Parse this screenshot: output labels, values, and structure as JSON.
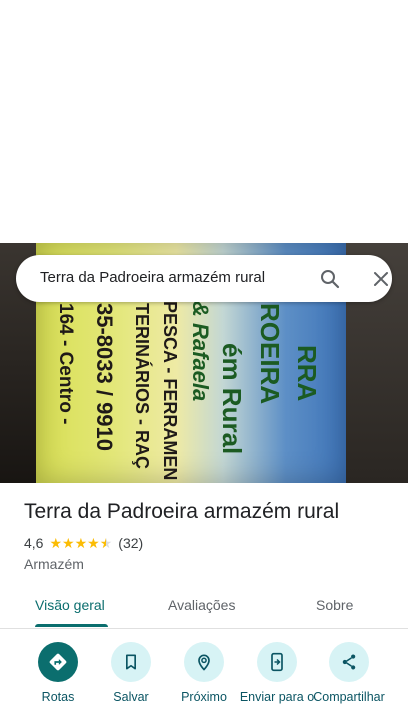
{
  "search": {
    "query": "Terra da Padroeira armazém rural"
  },
  "photo_text": {
    "line1": "RRA",
    "line2": "ROEIRA",
    "line3": "ém Rural",
    "line4": "& Rafaela",
    "line5": "PESCA - FERRAMEN",
    "line6": "TERINÁRIOS - RAÇ",
    "line7": "35-8033 / 9910",
    "line8": "164 - Centro -"
  },
  "place": {
    "title": "Terra da Padroeira armazém rural",
    "rating": "4,6",
    "reviews": "(32)",
    "category": "Armazém",
    "stars_value": 4.6
  },
  "tabs": [
    "Visão geral",
    "Avaliações",
    "Sobre"
  ],
  "actions": [
    {
      "label": "Rotas",
      "icon": "directions-icon"
    },
    {
      "label": "Salvar",
      "icon": "bookmark-icon"
    },
    {
      "label": "Próximo",
      "icon": "nearby-icon"
    },
    {
      "label": "Enviar para o",
      "icon": "send-to-phone-icon"
    },
    {
      "label": "Compartilhar",
      "icon": "share-icon"
    }
  ],
  "colors": {
    "accent": "#0b6e6e",
    "chip": "#d7f3f5",
    "star": "#fbbc04"
  }
}
